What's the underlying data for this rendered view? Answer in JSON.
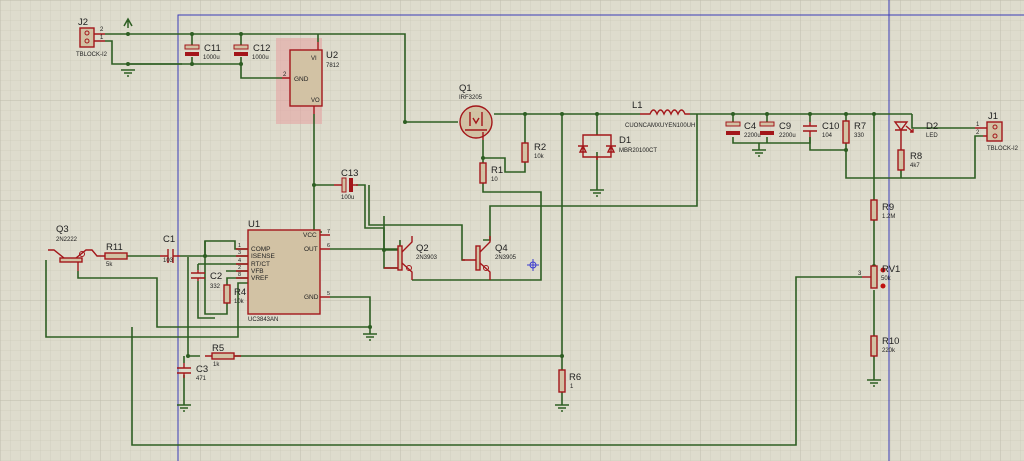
{
  "components": {
    "J2": {
      "ref": "J2",
      "value": "TBLOCK-I2",
      "pins": [
        "2",
        "1"
      ]
    },
    "J1": {
      "ref": "J1",
      "value": "TBLOCK-I2",
      "pins": [
        "1",
        "2"
      ]
    },
    "C11": {
      "ref": "C11",
      "value": "1000u"
    },
    "C12": {
      "ref": "C12",
      "value": "1000u"
    },
    "U2": {
      "ref": "U2",
      "value": "7812",
      "gnd": "GND",
      "vi": "VI",
      "vo": "VO",
      "pin_gnd": "2"
    },
    "Q1": {
      "ref": "Q1",
      "value": "IRF3205"
    },
    "R1": {
      "ref": "R1",
      "value": "10"
    },
    "R2": {
      "ref": "R2",
      "value": "10k"
    },
    "D1": {
      "ref": "D1",
      "value": "MBR20100CT"
    },
    "L1": {
      "ref": "L1",
      "value": "CUONCAMXUYEN100UH"
    },
    "C4": {
      "ref": "C4",
      "value": "2200u"
    },
    "C9": {
      "ref": "C9",
      "value": "2200u"
    },
    "C10": {
      "ref": "C10",
      "value": "104"
    },
    "R7": {
      "ref": "R7",
      "value": "330"
    },
    "D2": {
      "ref": "D2",
      "value": "LED"
    },
    "R8": {
      "ref": "R8",
      "value": "4k7"
    },
    "R9": {
      "ref": "R9",
      "value": "1.2M"
    },
    "RV1": {
      "ref": "RV1",
      "value": "50k",
      "pin": "3"
    },
    "R10": {
      "ref": "R10",
      "value": "220k"
    },
    "C13": {
      "ref": "C13",
      "value": "100u"
    },
    "U1": {
      "ref": "U1",
      "value": "UC3843AN",
      "left_pins": [
        {
          "num": "1",
          "name": "COMP"
        },
        {
          "num": "3",
          "name": "ISENSE"
        },
        {
          "num": "4",
          "name": "RT/CT"
        },
        {
          "num": "2",
          "name": "VFB"
        },
        {
          "num": "8",
          "name": "VREF"
        }
      ],
      "right_pins": [
        {
          "num": "7",
          "name": "VCC"
        },
        {
          "num": "6",
          "name": "OUT"
        },
        {
          "num": "5",
          "name": "GND"
        }
      ]
    },
    "Q2": {
      "ref": "Q2",
      "value": "2N3903"
    },
    "Q4": {
      "ref": "Q4",
      "value": "2N3905"
    },
    "Q3": {
      "ref": "Q3",
      "value": "2N2222"
    },
    "R11": {
      "ref": "R11",
      "value": "5k"
    },
    "C1": {
      "ref": "C1",
      "value": "103"
    },
    "C2": {
      "ref": "C2",
      "value": "332"
    },
    "R4": {
      "ref": "R4",
      "value": "10k"
    },
    "R5": {
      "ref": "R5",
      "value": "1k"
    },
    "C3": {
      "ref": "C3",
      "value": "471"
    },
    "R6": {
      "ref": "R6",
      "value": "1"
    }
  },
  "colors": {
    "wire": "#2e5e23",
    "component": "#a3161a",
    "body": "#d2c2a4",
    "frame": "#3b3bb8",
    "background": "#dedccd",
    "selection": "#e6a0a0"
  }
}
